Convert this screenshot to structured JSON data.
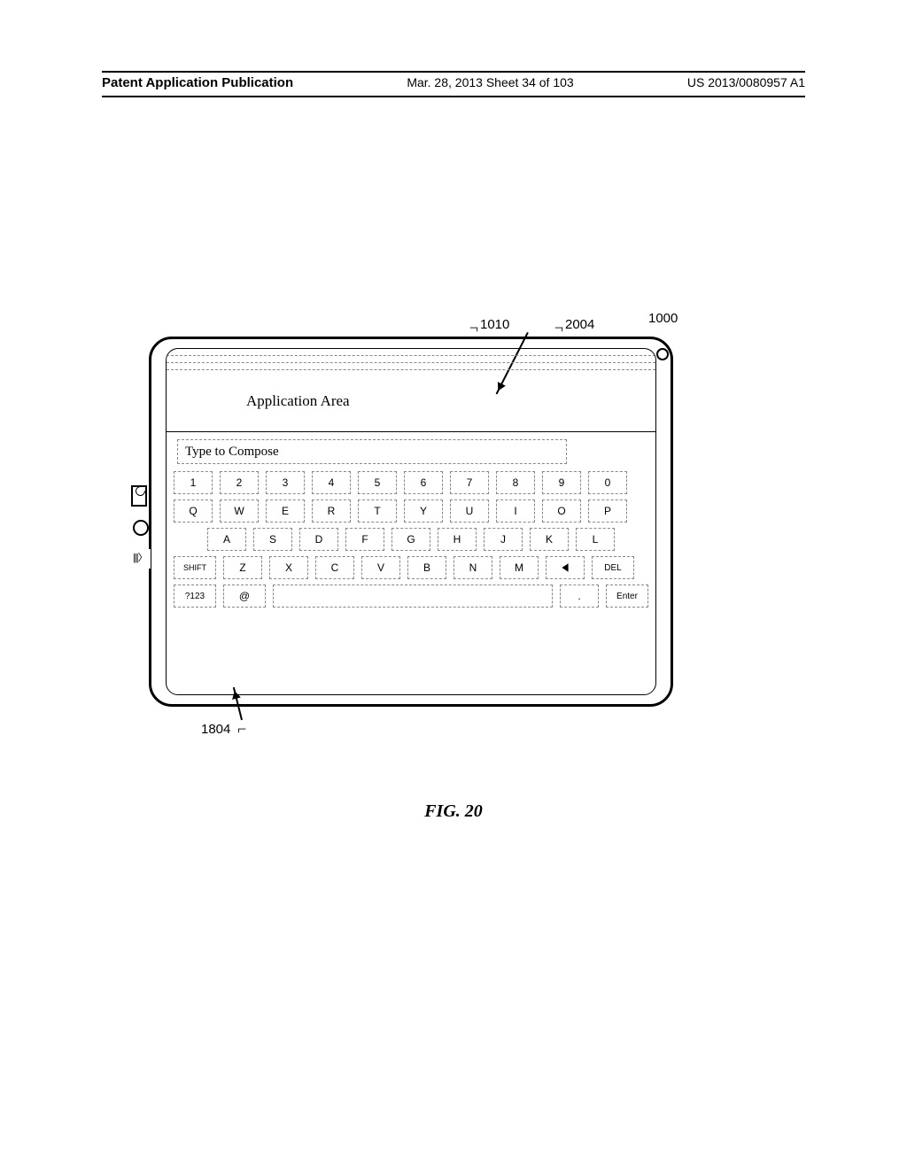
{
  "header": {
    "left": "Patent Application Publication",
    "center": "Mar. 28, 2013  Sheet 34 of 103",
    "right": "US 2013/0080957 A1"
  },
  "callouts": {
    "c1010": "1010",
    "c2004": "2004",
    "c1000": "1000",
    "c1804": "1804"
  },
  "screen": {
    "application_area_label": "Application Area",
    "compose_placeholder": "Type to Compose"
  },
  "keyboard": {
    "row_num": [
      "1",
      "2",
      "3",
      "4",
      "5",
      "6",
      "7",
      "8",
      "9",
      "0"
    ],
    "row_q": [
      "Q",
      "W",
      "E",
      "R",
      "T",
      "Y",
      "U",
      "I",
      "O",
      "P"
    ],
    "row_a": [
      "A",
      "S",
      "D",
      "F",
      "G",
      "H",
      "J",
      "K",
      "L"
    ],
    "row_z": [
      "Z",
      "X",
      "C",
      "V",
      "B",
      "N",
      "M"
    ],
    "shift": "SHIFT",
    "del": "DEL",
    "sym": "?123",
    "at": "@",
    "period": ".",
    "enter": "Enter"
  },
  "figure_caption": "FIG. 20"
}
